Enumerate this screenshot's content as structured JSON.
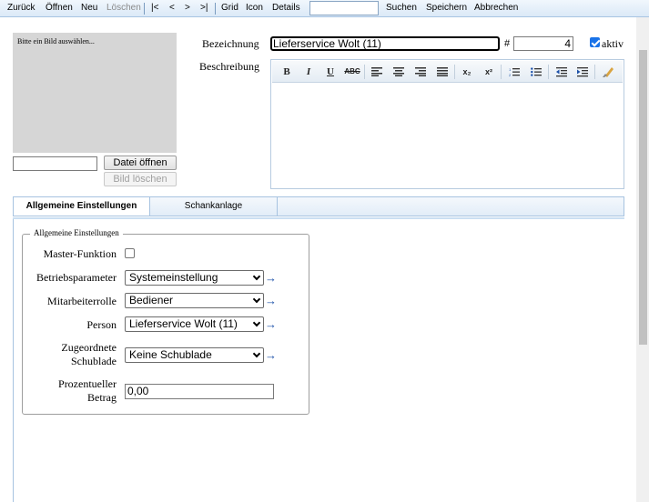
{
  "toolbar": {
    "back": "Zurück",
    "open": "Öffnen",
    "new": "Neu",
    "delete": "Löschen",
    "first": "|<",
    "prev": "<",
    "next": ">",
    "last": ">|",
    "grid": "Grid",
    "icon": "Icon",
    "details": "Details",
    "search_value": "",
    "search": "Suchen",
    "save": "Speichern",
    "cancel": "Abbrechen"
  },
  "image_panel": {
    "hint": "Bitte ein Bild auswählen...",
    "file_value": "",
    "open_file": "Datei öffnen",
    "delete_image": "Bild löschen"
  },
  "header": {
    "name_label": "Bezeichnung",
    "name_value": "Lieferservice Wolt (11)",
    "hash_label": "#",
    "number_value": "4",
    "active_label": "aktiv",
    "active_checked": true,
    "description_label": "Beschreibung"
  },
  "editor": {
    "buttons": [
      {
        "name": "bold-icon",
        "glyph": "B"
      },
      {
        "name": "italic-icon",
        "glyph": "I"
      },
      {
        "name": "underline-icon",
        "glyph": "U"
      },
      {
        "name": "strikethrough-icon",
        "glyph": "ABC"
      },
      {
        "name": "align-left-icon",
        "glyph": "≡"
      },
      {
        "name": "align-center-icon",
        "glyph": "≡"
      },
      {
        "name": "align-right-icon",
        "glyph": "≡"
      },
      {
        "name": "align-justify-icon",
        "glyph": "≡"
      },
      {
        "name": "subscript-icon",
        "glyph": "x₂"
      },
      {
        "name": "superscript-icon",
        "glyph": "x²"
      },
      {
        "name": "ordered-list-icon",
        "glyph": "⒈"
      },
      {
        "name": "unordered-list-icon",
        "glyph": "•"
      },
      {
        "name": "outdent-icon",
        "glyph": "⇤"
      },
      {
        "name": "indent-icon",
        "glyph": "⇥"
      },
      {
        "name": "clear-format-icon",
        "glyph": "✎"
      }
    ]
  },
  "tabs": [
    {
      "label": "Allgemeine Einstellungen",
      "active": true
    },
    {
      "label": "Schankanlage",
      "active": false
    }
  ],
  "general": {
    "legend": "Allgemeine Einstellungen",
    "master_label": "Master-Funktion",
    "master_checked": false,
    "operating_label": "Betriebsparameter",
    "operating_value": "Systemeinstellung",
    "role_label": "Mitarbeiterrolle",
    "role_value": "Bediener",
    "person_label": "Person",
    "person_value": "Lieferservice Wolt (11)",
    "drawer_label_line1": "Zugeordnete",
    "drawer_label_line2": "Schublade",
    "drawer_value": "Keine Schublade",
    "percent_label_line1": "Prozentueller",
    "percent_label_line2": "Betrag",
    "percent_value": "0,00",
    "arrow_glyph": "→"
  }
}
